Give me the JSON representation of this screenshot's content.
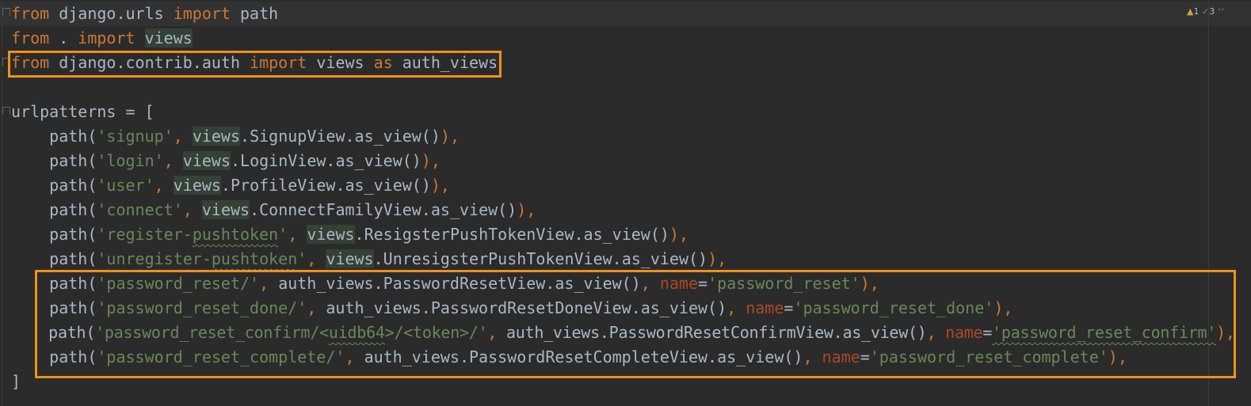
{
  "inspections": {
    "warnings": "1",
    "weak_warnings": "3",
    "arrow_up": "˄",
    "arrow_down": "˅"
  },
  "code": {
    "l1_kw1": "from",
    "l1_mod": " django.urls ",
    "l1_kw2": "import",
    "l1_name": " path",
    "l2_kw1": "from",
    "l2_dot": " . ",
    "l2_kw2": "import",
    "l2_sp": " ",
    "l2_views": "views",
    "l3_kw1": "from",
    "l3_mod": " django.contrib.auth ",
    "l3_kw2": "import",
    "l3_views": " views ",
    "l3_kw3": "as",
    "l3_alias": " auth_views",
    "l5": "urlpatterns = [",
    "indent": "    ",
    "path_open": "path(",
    "comma_sp": ", ",
    "views": "views",
    "close_comma": "),",
    "name_kw": "name",
    "eq": "=",
    "l6_str": "'signup'",
    "l6_rest": ".SignupView.as_view()",
    "l7_str": "'login'",
    "l7_rest": ".LoginView.as_view()",
    "l8_str": "'user'",
    "l8_rest": ".ProfileView.as_view()",
    "l9_str": "'connect'",
    "l9_rest": ".ConnectFamilyView.as_view()",
    "l10_str_a": "'register-",
    "l10_str_b": "pushtoken",
    "l10_str_c": "'",
    "l10_rest": ".ResigsterPushTokenView.as_view()",
    "l11_str_a": "'unregister-",
    "l11_str_b": "pushtoken",
    "l11_str_c": "'",
    "l11_rest": ".UnresigsterPushTokenView.as_view()",
    "l12_str": "'password_reset/'",
    "l12_rest": "auth_views.PasswordResetView.as_view()",
    "l12_name": "'password_reset'",
    "l13_str": "'password_reset_done/'",
    "l13_rest": "auth_views.PasswordResetDoneView.as_view()",
    "l13_name": "'password_reset_done'",
    "l14_str_a": "'password_reset_confirm/<",
    "l14_str_b": "uidb64",
    "l14_str_c": ">/<token>/'",
    "l14_rest": "auth_views.PasswordResetConfirmView.as_view()",
    "l14_name": "'password_reset_confirm'",
    "l15_str": "'password_reset_complete/'",
    "l15_rest": "auth_views.PasswordResetCompleteView.as_view()",
    "l15_name": "'password_reset_complete'",
    "l16": "]"
  },
  "colors": {
    "background": "#2b2b2b",
    "keyword": "#cc7832",
    "string": "#6a8759",
    "parameter": "#aa4926",
    "text": "#a9b7c6",
    "highlight_box": "#f0901a"
  }
}
